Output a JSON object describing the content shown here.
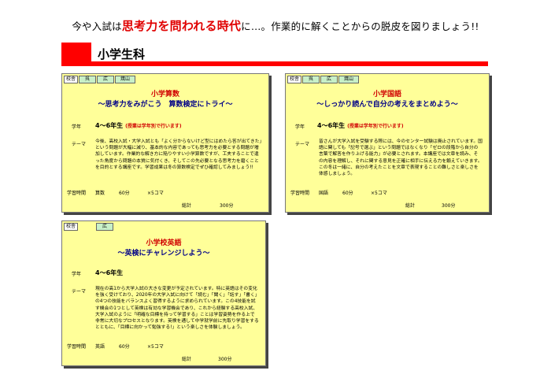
{
  "headline": {
    "prefix": "今や入試は",
    "highlight": "思考力を問われる時代",
    "suffix": "に…。作業的に解くことからの脱皮を図りましょう!!"
  },
  "section": {
    "title": "小学生科"
  },
  "labels": {
    "grade": "学年",
    "theme": "テーマ",
    "study_time": "学習時間",
    "total": "総計"
  },
  "cards": [
    {
      "tags": [
        "校舎",
        "呉",
        "広",
        "焼山"
      ],
      "title": "小学算数",
      "subtitle": "～思考力をみがこう　算数検定にトライ～",
      "grade": "4～6年生",
      "grade_note": "(授業は学年別で行います)",
      "theme_text": "今後、高校入試・大学入試とも「よく分からないけど型にはめたら答が出てきた」という問題が大幅に減り、基本的な内容であっても思考力を必要とする問題が増加しています。作業的な解き方に陥りやすい小学算数ですが、工夫することで違った角度から問題の本質に気付くき、そしてこの先必要となる思考力を磨くことを目的とする講座です。学習成果は冬の算数検定でぜひ確認してみましょう!!",
      "subject": "算数",
      "minutes": "60分",
      "sessions": "×5コマ",
      "total": "300分"
    },
    {
      "tags": [
        "校舎",
        "呉",
        "広",
        "焼山"
      ],
      "title": "小学国語",
      "subtitle": "～しっかり読んで自分の考えをまとめよう～",
      "grade": "4～6年生",
      "grade_note": "(授業は学年別で行います)",
      "theme_text": "皆さんが大学入試を受験する際には、今のセンター試験は廃止されています。国語に関しても「記号で選ぶ」という問題ではなくなり「ゼロの段階から自分の言葉で解答を作り上げる能力」が必要とされます。本講座では文章を読み、その内容を理解し、それに関する意見を正確に相手に伝える力を鍛えていきます。この冬は一緒に、自分の考えたことを文章で表現することの難しさと楽しさを体感しましょう。",
      "subject": "国語",
      "minutes": "60分",
      "sessions": "×5コマ",
      "total": "300分"
    },
    {
      "tags": [
        "校舎",
        "広"
      ],
      "title": "小学校英語",
      "subtitle": "～英検にチャレンジしよう～",
      "grade": "4～6年生",
      "grade_note": "",
      "theme_text": "現在の高1から大学入試の大きな変更が予定されています。特に英語はその変化を強く受けており、2020年の大学入試に向けて「読む」「聞く」「話す」「書く」の4つの技能をバランスよく習得するように求められています。この4技能を試す機会の1つとして英検は有効な学習機会であり、これから経験する高校入試、大学入試のように「明確な目標を持って学習する」ことは学習姿勢を作る上で非常に大切なプロセスとなります。英検を通して中学就学前に先取り学習をするとともに、「目標に向かって勉強する!」という楽しさを体験しましょう。",
      "subject": "英語",
      "minutes": "60分",
      "sessions": "×5コマ",
      "total": "300分"
    }
  ]
}
